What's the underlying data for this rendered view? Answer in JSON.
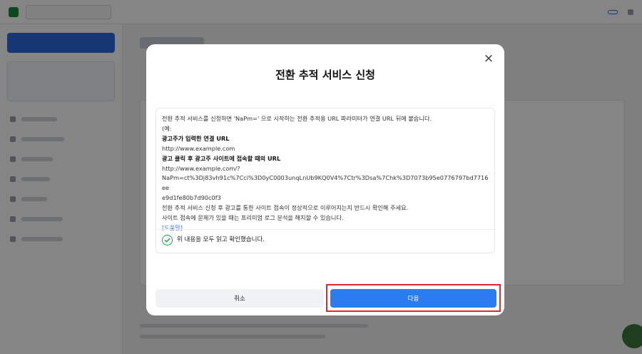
{
  "modal": {
    "title": "전환 추적 서비스 신청",
    "close_symbol": "×",
    "lines": {
      "intro": "전환 추적 서비스를 신청하면 'NaPm=' 으로 시작하는 전환 추적용 URL 파라미터가 연결 URL 뒤에 붙습니다.",
      "example_open": "(예:",
      "heading1": "광고주가 입력한 연결 URL",
      "url1": "http://www.example.com",
      "heading2": "광고 클릭 후 광고주 사이트에 접속할 때의 URL",
      "url2_a": "http://www.example.com/?",
      "url2_b": "NaPm=ct%3Dj83vh91c%7Cci%3D0yC0003unqLnUb9KQ0V4%7Ctr%3Dsa%7Chk%3D7073b95e0776797bd7716ee",
      "url2_c": "e9d1fe80b7d90c0f3",
      "notice1": "전환 추적 서비스 신청 후 광고를 통한 사이트 접속이 정상적으로 이루어지는지 반드시 확인해 주세요.",
      "notice2": "사이트 접속에 문제가 있을 때는 프리미엄 로그 분석을 해지할 수 있습니다.",
      "help_link": "[도움말]"
    },
    "agree_label": "위 내용을 모두 읽고 확인했습니다.",
    "cancel_label": "취소",
    "next_label": "다음"
  },
  "colors": {
    "primary": "#2d7bf0",
    "check": "#1fa34a",
    "highlight": "#e0282e"
  }
}
